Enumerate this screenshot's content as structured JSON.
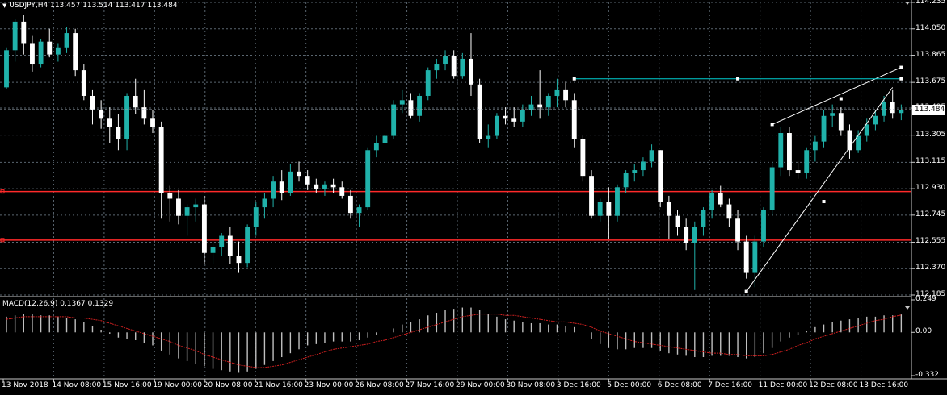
{
  "window": {
    "symbol_label": "USDJPY,H4",
    "ohlc_label": "113.457 113.514 113.417 113.484",
    "dropdown_glyph": "▼"
  },
  "chart_data": [
    {
      "type": "candlestick",
      "title": "USDJPY,H4",
      "price_axis_ticks": [
        "114.235",
        "114.050",
        "113.865",
        "113.675",
        "113.495",
        "113.305",
        "113.115",
        "112.930",
        "112.745",
        "112.555",
        "112.370",
        "112.185"
      ],
      "current_price_label": "113.484",
      "ylim": [
        112.185,
        114.235
      ],
      "x_tick_labels": [
        "13 Nov 2018",
        "14 Nov 08:00",
        "15 Nov 16:00",
        "19 Nov 00:00",
        "20 Nov 08:00",
        "21 Nov 16:00",
        "23 Nov 00:00",
        "26 Nov 08:00",
        "27 Nov 16:00",
        "29 Nov 00:00",
        "30 Nov 08:00",
        "3 Dec 16:00",
        "5 Dec 00:00",
        "6 Dec 08:00",
        "7 Dec 16:00",
        "11 Dec 00:00",
        "12 Dec 08:00",
        "13 Dec 16:00"
      ],
      "grid": true,
      "colors": {
        "bull": "#20B2AA",
        "bear": "#FFFFFF",
        "background": "#000000",
        "grid": "#5A6670",
        "hline": "#FF2A2A",
        "trend": "#FFFFFF",
        "channel": "#00CED1"
      },
      "horizontal_levels": [
        112.91,
        112.57
      ],
      "candles": [
        [
          113.64,
          113.92,
          113.63,
          113.9
        ],
        [
          113.9,
          114.12,
          113.82,
          114.1
        ],
        [
          114.1,
          114.15,
          113.87,
          113.95
        ],
        [
          113.95,
          114.0,
          113.75,
          113.8
        ],
        [
          113.8,
          113.98,
          113.78,
          113.96
        ],
        [
          113.96,
          114.05,
          113.85,
          113.87
        ],
        [
          113.87,
          113.95,
          113.82,
          113.92
        ],
        [
          113.92,
          114.06,
          113.88,
          114.02
        ],
        [
          114.02,
          114.05,
          113.72,
          113.76
        ],
        [
          113.76,
          113.8,
          113.55,
          113.58
        ],
        [
          113.58,
          113.62,
          113.38,
          113.48
        ],
        [
          113.48,
          113.55,
          113.35,
          113.42
        ],
        [
          113.42,
          113.5,
          113.25,
          113.36
        ],
        [
          113.36,
          113.45,
          113.2,
          113.28
        ],
        [
          113.28,
          113.6,
          113.2,
          113.58
        ],
        [
          113.58,
          113.7,
          113.45,
          113.5
        ],
        [
          113.5,
          113.62,
          113.38,
          113.42
        ],
        [
          113.42,
          113.48,
          113.32,
          113.36
        ],
        [
          113.36,
          113.4,
          112.72,
          112.9
        ],
        [
          112.9,
          112.95,
          112.7,
          112.86
        ],
        [
          112.86,
          112.92,
          112.68,
          112.74
        ],
        [
          112.74,
          112.82,
          112.6,
          112.8
        ],
        [
          112.8,
          112.86,
          112.7,
          112.82
        ],
        [
          112.82,
          112.88,
          112.4,
          112.48
        ],
        [
          112.48,
          112.56,
          112.4,
          112.52
        ],
        [
          112.52,
          112.62,
          112.46,
          112.6
        ],
        [
          112.6,
          112.66,
          112.4,
          112.46
        ],
        [
          112.46,
          112.56,
          112.34,
          112.41
        ],
        [
          112.41,
          112.68,
          112.38,
          112.66
        ],
        [
          112.66,
          112.84,
          112.6,
          112.8
        ],
        [
          112.8,
          112.9,
          112.72,
          112.86
        ],
        [
          112.86,
          113.02,
          112.8,
          112.98
        ],
        [
          112.98,
          113.06,
          112.85,
          112.9
        ],
        [
          112.9,
          113.1,
          112.88,
          113.05
        ],
        [
          113.05,
          113.12,
          112.98,
          113.02
        ],
        [
          113.02,
          113.06,
          112.92,
          112.96
        ],
        [
          112.96,
          113.0,
          112.9,
          112.93
        ],
        [
          112.93,
          112.98,
          112.88,
          112.96
        ],
        [
          112.96,
          113.0,
          112.9,
          112.94
        ],
        [
          112.94,
          112.98,
          112.86,
          112.88
        ],
        [
          112.88,
          112.92,
          112.72,
          112.76
        ],
        [
          112.76,
          112.82,
          112.66,
          112.8
        ],
        [
          112.8,
          113.22,
          112.78,
          113.2
        ],
        [
          113.2,
          113.3,
          113.15,
          113.25
        ],
        [
          113.25,
          113.32,
          113.18,
          113.3
        ],
        [
          113.3,
          113.55,
          113.28,
          113.52
        ],
        [
          113.52,
          113.62,
          113.46,
          113.55
        ],
        [
          113.55,
          113.6,
          113.42,
          113.44
        ],
        [
          113.44,
          113.6,
          113.4,
          113.58
        ],
        [
          113.58,
          113.78,
          113.55,
          113.76
        ],
        [
          113.76,
          113.84,
          113.7,
          113.8
        ],
        [
          113.8,
          113.9,
          113.76,
          113.86
        ],
        [
          113.86,
          113.9,
          113.7,
          113.72
        ],
        [
          113.72,
          113.88,
          113.7,
          113.84
        ],
        [
          113.84,
          114.02,
          113.58,
          113.66
        ],
        [
          113.66,
          113.7,
          113.25,
          113.28
        ],
        [
          113.28,
          113.38,
          113.22,
          113.3
        ],
        [
          113.3,
          113.46,
          113.28,
          113.44
        ],
        [
          113.44,
          113.5,
          113.38,
          113.42
        ],
        [
          113.42,
          113.5,
          113.36,
          113.4
        ],
        [
          113.4,
          113.52,
          113.36,
          113.48
        ],
        [
          113.48,
          113.58,
          113.44,
          113.52
        ],
        [
          113.52,
          113.76,
          113.42,
          113.5
        ],
        [
          113.5,
          113.6,
          113.44,
          113.58
        ],
        [
          113.58,
          113.7,
          113.5,
          113.62
        ],
        [
          113.62,
          113.68,
          113.5,
          113.55
        ],
        [
          113.55,
          113.6,
          113.22,
          113.28
        ],
        [
          113.28,
          113.3,
          112.98,
          113.02
        ],
        [
          113.02,
          113.06,
          112.72,
          112.74
        ],
        [
          112.74,
          112.86,
          112.7,
          112.84
        ],
        [
          112.84,
          112.94,
          112.58,
          112.74
        ],
        [
          112.74,
          112.96,
          112.7,
          112.94
        ],
        [
          112.94,
          113.06,
          112.9,
          113.04
        ],
        [
          113.04,
          113.1,
          112.98,
          113.06
        ],
        [
          113.06,
          113.15,
          113.02,
          113.12
        ],
        [
          113.12,
          113.24,
          113.08,
          113.2
        ],
        [
          113.2,
          113.2,
          112.8,
          112.84
        ],
        [
          112.84,
          112.88,
          112.58,
          112.74
        ],
        [
          112.74,
          112.78,
          112.6,
          112.66
        ],
        [
          112.66,
          112.72,
          112.5,
          112.55
        ],
        [
          112.55,
          112.7,
          112.22,
          112.66
        ],
        [
          112.66,
          112.8,
          112.6,
          112.78
        ],
        [
          112.78,
          112.92,
          112.72,
          112.9
        ],
        [
          112.9,
          112.95,
          112.8,
          112.82
        ],
        [
          112.82,
          112.86,
          112.66,
          112.72
        ],
        [
          112.72,
          112.78,
          112.5,
          112.56
        ],
        [
          112.56,
          112.6,
          112.3,
          112.34
        ],
        [
          112.34,
          112.6,
          112.24,
          112.56
        ],
        [
          112.56,
          112.8,
          112.52,
          112.78
        ],
        [
          112.78,
          113.12,
          112.74,
          113.08
        ],
        [
          113.08,
          113.36,
          113.02,
          113.32
        ],
        [
          113.32,
          113.36,
          113.02,
          113.06
        ],
        [
          113.06,
          113.12,
          113.0,
          113.04
        ],
        [
          113.04,
          113.22,
          113.0,
          113.2
        ],
        [
          113.2,
          113.3,
          113.12,
          113.26
        ],
        [
          113.26,
          113.48,
          113.22,
          113.44
        ],
        [
          113.44,
          113.52,
          113.36,
          113.46
        ],
        [
          113.46,
          113.5,
          113.3,
          113.34
        ],
        [
          113.34,
          113.38,
          113.14,
          113.2
        ],
        [
          113.2,
          113.34,
          113.18,
          113.3
        ],
        [
          113.3,
          113.42,
          113.26,
          113.38
        ],
        [
          113.38,
          113.48,
          113.34,
          113.44
        ],
        [
          113.44,
          113.58,
          113.4,
          113.54
        ],
        [
          113.54,
          113.62,
          113.42,
          113.46
        ],
        [
          113.46,
          113.52,
          113.41,
          113.484
        ]
      ]
    },
    {
      "type": "histogram+line",
      "title": "MACD(12,26,9) 0.1367 0.1329",
      "axis_ticks": [
        "0.249",
        "0.00",
        "-0.332"
      ],
      "ylim": [
        -0.332,
        0.249
      ],
      "colors": {
        "hist": "#C0C0C0",
        "signal": "#D02020"
      },
      "macd": [
        0.12,
        0.13,
        0.14,
        0.14,
        0.13,
        0.13,
        0.12,
        0.11,
        0.1,
        0.08,
        0.05,
        0.02,
        -0.01,
        -0.04,
        -0.05,
        -0.06,
        -0.08,
        -0.1,
        -0.14,
        -0.17,
        -0.2,
        -0.22,
        -0.24,
        -0.26,
        -0.28,
        -0.29,
        -0.3,
        -0.31,
        -0.3,
        -0.28,
        -0.25,
        -0.22,
        -0.19,
        -0.16,
        -0.13,
        -0.1,
        -0.09,
        -0.08,
        -0.07,
        -0.07,
        -0.07,
        -0.06,
        -0.04,
        -0.02,
        0.0,
        0.03,
        0.06,
        0.08,
        0.1,
        0.13,
        0.15,
        0.17,
        0.18,
        0.19,
        0.19,
        0.17,
        0.14,
        0.12,
        0.1,
        0.09,
        0.08,
        0.07,
        0.07,
        0.06,
        0.06,
        0.05,
        0.04,
        0.0,
        -0.05,
        -0.09,
        -0.12,
        -0.13,
        -0.13,
        -0.12,
        -0.12,
        -0.12,
        -0.14,
        -0.16,
        -0.17,
        -0.18,
        -0.19,
        -0.19,
        -0.18,
        -0.18,
        -0.18,
        -0.19,
        -0.2,
        -0.19,
        -0.16,
        -0.12,
        -0.07,
        -0.04,
        -0.02,
        0.01,
        0.04,
        0.06,
        0.08,
        0.09,
        0.1,
        0.11,
        0.12,
        0.12,
        0.13,
        0.13,
        0.137
      ],
      "signal": [
        0.1,
        0.11,
        0.12,
        0.12,
        0.12,
        0.12,
        0.12,
        0.12,
        0.11,
        0.11,
        0.1,
        0.09,
        0.07,
        0.05,
        0.03,
        0.01,
        -0.01,
        -0.03,
        -0.05,
        -0.07,
        -0.1,
        -0.12,
        -0.14,
        -0.17,
        -0.19,
        -0.21,
        -0.23,
        -0.25,
        -0.26,
        -0.27,
        -0.27,
        -0.26,
        -0.25,
        -0.23,
        -0.21,
        -0.19,
        -0.17,
        -0.15,
        -0.13,
        -0.12,
        -0.11,
        -0.1,
        -0.09,
        -0.07,
        -0.06,
        -0.04,
        -0.02,
        0.0,
        0.02,
        0.04,
        0.06,
        0.08,
        0.1,
        0.12,
        0.13,
        0.14,
        0.14,
        0.14,
        0.13,
        0.13,
        0.12,
        0.11,
        0.1,
        0.09,
        0.08,
        0.08,
        0.07,
        0.06,
        0.04,
        0.01,
        -0.01,
        -0.03,
        -0.05,
        -0.07,
        -0.08,
        -0.09,
        -0.1,
        -0.11,
        -0.12,
        -0.13,
        -0.14,
        -0.15,
        -0.16,
        -0.16,
        -0.17,
        -0.17,
        -0.18,
        -0.18,
        -0.18,
        -0.17,
        -0.15,
        -0.13,
        -0.1,
        -0.08,
        -0.05,
        -0.03,
        -0.01,
        0.01,
        0.03,
        0.05,
        0.07,
        0.09,
        0.1,
        0.12,
        0.133
      ]
    }
  ]
}
